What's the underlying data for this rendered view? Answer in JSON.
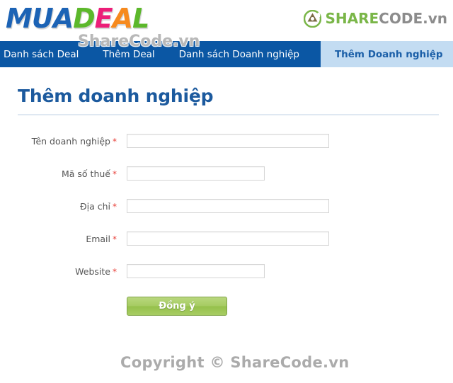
{
  "header": {
    "logo": {
      "name": "muadeal-logo",
      "letters": [
        {
          "char": "M",
          "color": "#1c63b5"
        },
        {
          "char": "U",
          "color": "#1c63b5"
        },
        {
          "char": "A",
          "color": "#1c63b5"
        },
        {
          "char": "D",
          "color": "#5cb82b"
        },
        {
          "char": "E",
          "color": "#ec1e78"
        },
        {
          "char": "A",
          "color": "#f68a1e"
        },
        {
          "char": "L",
          "color": "#5cb82b"
        }
      ]
    },
    "sharecode": {
      "icon_name": "sharecode-recycle-icon",
      "text_green": "SHARE",
      "text_gray": "CODE.vn",
      "green": "#7ab648",
      "gray": "#8c8c8c"
    },
    "watermark": "ShareCode.vn"
  },
  "nav": {
    "background": "#0b57a4",
    "active_background": "#c3dcf2",
    "active_text_color": "#1b5fa8",
    "items": [
      {
        "label": "Danh sách Deal",
        "active": false
      },
      {
        "label": "Thêm Deal",
        "active": false
      },
      {
        "label": "Danh sách Doanh nghiệp",
        "active": false
      },
      {
        "label": "Thêm Doanh nghiệp",
        "active": true
      }
    ]
  },
  "page": {
    "title": "Thêm doanh nghiệp",
    "title_color": "#1c5a9e"
  },
  "form": {
    "required_marker": "*",
    "fields": [
      {
        "label": "Tên doanh nghiệp",
        "required": true,
        "value": "",
        "placeholder": "",
        "width": "wide"
      },
      {
        "label": "Mã số thuế",
        "required": true,
        "value": "",
        "placeholder": "",
        "width": "narrow"
      },
      {
        "label": "Địa chỉ",
        "required": true,
        "value": "",
        "placeholder": "",
        "width": "wide"
      },
      {
        "label": "Email",
        "required": true,
        "value": "",
        "placeholder": "",
        "width": "wide"
      },
      {
        "label": "Website",
        "required": true,
        "value": "",
        "placeholder": "",
        "width": "narrow"
      }
    ],
    "submit_label": "Đồng ý",
    "submit_color": "#9dc756"
  },
  "watermark_bottom": "Copyright © ShareCode.vn"
}
